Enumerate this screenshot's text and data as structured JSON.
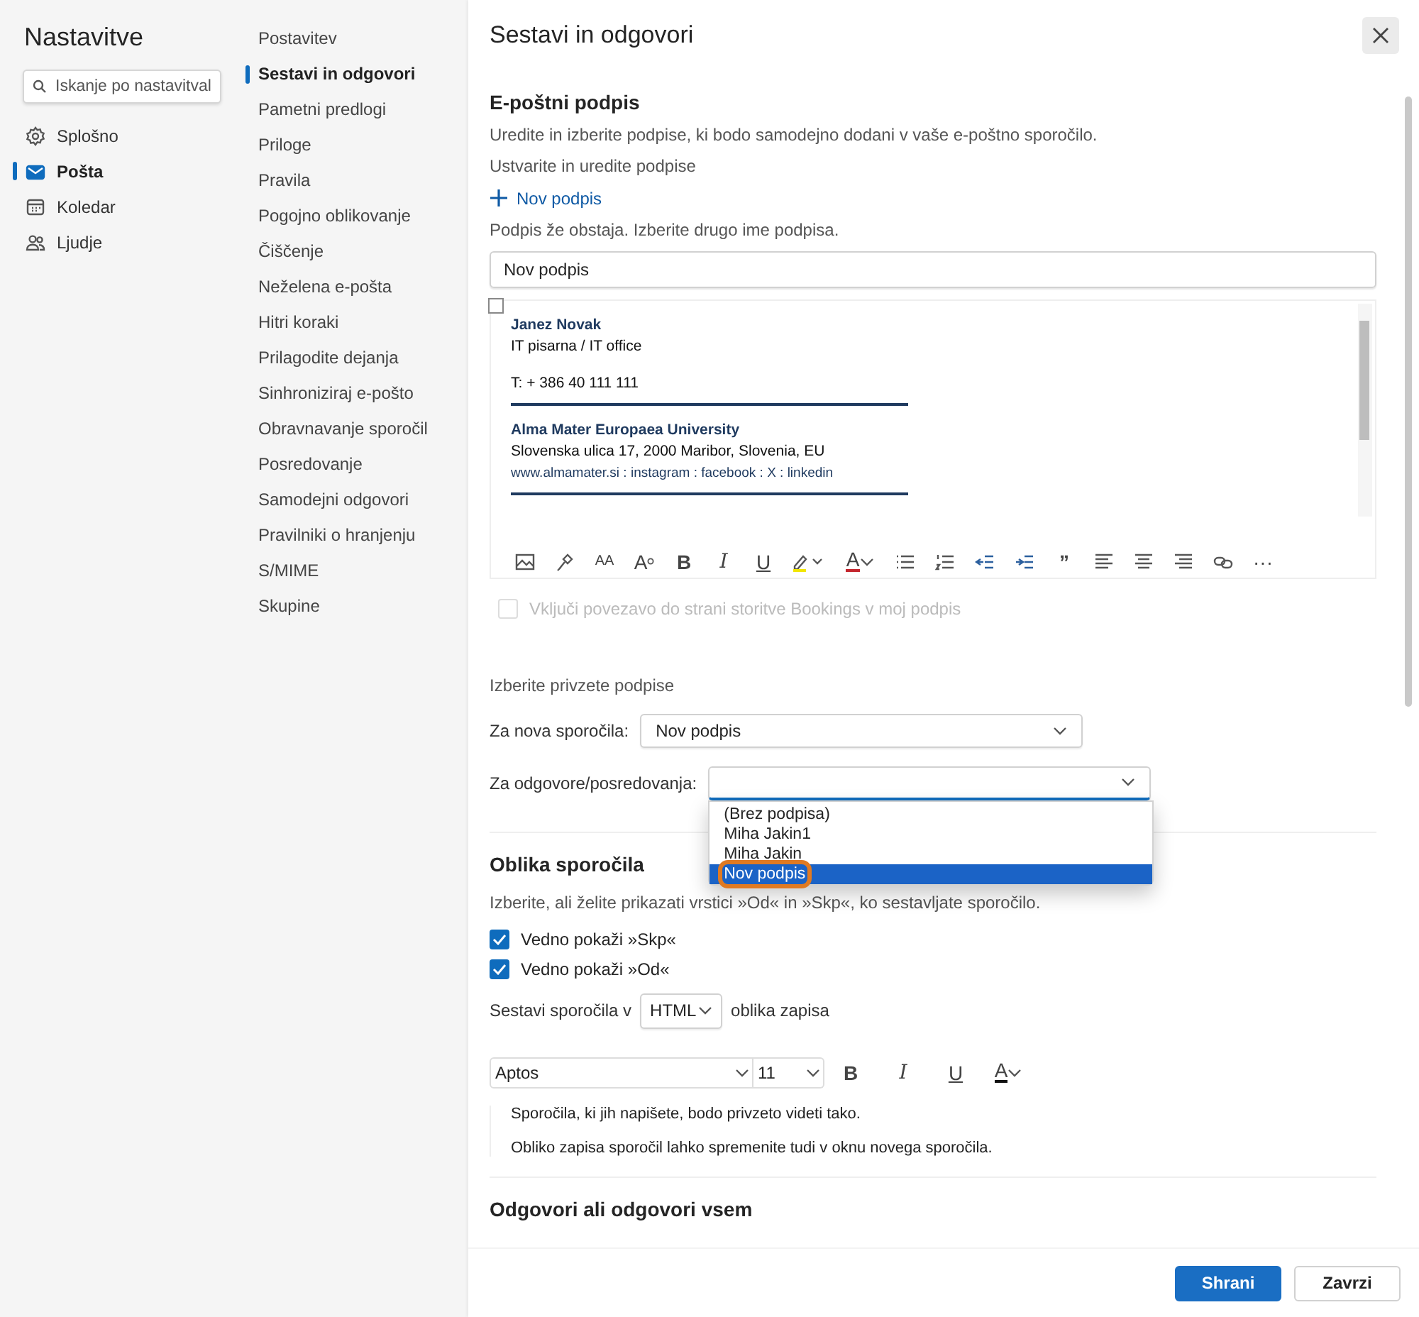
{
  "nav": {
    "title": "Nastavitve",
    "search": {
      "placeholder": "Iskanje po nastavitval"
    },
    "items": [
      {
        "kind": "general",
        "label": "Splošno",
        "selected": false
      },
      {
        "kind": "mail",
        "label": "Pošta",
        "selected": true
      },
      {
        "kind": "calendar",
        "label": "Koledar",
        "selected": false
      },
      {
        "kind": "people",
        "label": "Ljudje",
        "selected": false
      }
    ]
  },
  "sections": [
    {
      "label": "Postavitev",
      "selected": false
    },
    {
      "label": "Sestavi in odgovori",
      "selected": true
    },
    {
      "label": "Pametni predlogi",
      "selected": false
    },
    {
      "label": "Priloge",
      "selected": false
    },
    {
      "label": "Pravila",
      "selected": false
    },
    {
      "label": "Pogojno oblikovanje",
      "selected": false
    },
    {
      "label": "Čiščenje",
      "selected": false
    },
    {
      "label": "Neželena e-pošta",
      "selected": false
    },
    {
      "label": "Hitri koraki",
      "selected": false
    },
    {
      "label": "Prilagodite dejanja",
      "selected": false
    },
    {
      "label": "Sinhroniziraj e-pošto",
      "selected": false
    },
    {
      "label": "Obravnavanje sporočil",
      "selected": false
    },
    {
      "label": "Posredovanje",
      "selected": false
    },
    {
      "label": "Samodejni odgovori",
      "selected": false
    },
    {
      "label": "Pravilniki o hranjenju",
      "selected": false
    },
    {
      "label": "S/MIME",
      "selected": false
    },
    {
      "label": "Skupine",
      "selected": false
    }
  ],
  "panel": {
    "title": "Sestavi in odgovori",
    "signature": {
      "heading": "E-poštni podpis",
      "description": "Uredite in izberite podpise, ki bodo samodejno dodani v vaše e-poštno sporočilo.",
      "create_label": "Ustvarite in uredite podpise",
      "new_link": "Nov podpis",
      "error": "Podpis že obstaja. Izberite drugo ime podpisa.",
      "name_field": {
        "value": "Nov podpis"
      },
      "editor": {
        "select_all": {
          "checked": false
        },
        "lines": [
          {
            "kind": "name",
            "text": "Janez Novak"
          },
          {
            "kind": "plain",
            "text": "IT pisarna / IT office"
          },
          {
            "kind": "plain",
            "text": "T: + 386 40 111 111"
          },
          {
            "kind": "rule"
          },
          {
            "kind": "name",
            "text": "Alma Mater Europaea University"
          },
          {
            "kind": "plain",
            "text": "Slovenska ulica 17, 2000 Maribor, Slovenia, EU"
          },
          {
            "kind": "links",
            "text": "www.almamater.si : instagram : facebook : X : linkedin"
          },
          {
            "kind": "rule"
          }
        ],
        "toolbar": [
          {
            "kind": "image"
          },
          {
            "kind": "painter"
          },
          {
            "kind": "fontsize",
            "label": "AA"
          },
          {
            "kind": "superscript",
            "label": "A"
          },
          {
            "kind": "bold",
            "label": "B"
          },
          {
            "kind": "italic",
            "label": "I"
          },
          {
            "kind": "underline",
            "label": "U"
          },
          {
            "kind": "highlight"
          },
          {
            "kind": "fontcolor",
            "label": "A"
          },
          {
            "kind": "bullets"
          },
          {
            "kind": "numbering"
          },
          {
            "kind": "outdent"
          },
          {
            "kind": "indent"
          },
          {
            "kind": "quote",
            "label": "”"
          },
          {
            "kind": "alignleft"
          },
          {
            "kind": "aligncenter"
          },
          {
            "kind": "alignright"
          },
          {
            "kind": "link"
          },
          {
            "kind": "more",
            "label": "···"
          }
        ]
      },
      "bookings": {
        "label": "Vključi povezavo do strani storitve Bookings v moj podpis",
        "checked": false,
        "disabled": true
      }
    },
    "defaults": {
      "heading": "Izberite privzete podpise",
      "new_messages": {
        "label": "Za nova sporočila:",
        "value": "Nov podpis"
      },
      "replies": {
        "label": "Za odgovore/posredovanja:",
        "expanded": true,
        "options": [
          {
            "label": "(Brez podpisa)",
            "selected": false
          },
          {
            "label": "Miha Jakin1",
            "selected": false
          },
          {
            "label": "Miha Jakin",
            "selected": false
          },
          {
            "label": "Nov podpis",
            "selected": true
          }
        ]
      }
    },
    "format": {
      "heading": "Oblika sporočila",
      "description": "Izberite, ali želite prikazati vrstici »Od« in »Skp«, ko sestavljate sporočilo.",
      "options": [
        {
          "label": "Vedno pokaži »Skp«",
          "checked": true
        },
        {
          "label": "Vedno pokaži »Od«",
          "checked": true
        }
      ],
      "compose_before": "Sestavi sporočila v",
      "compose_value": "HTML",
      "compose_after": "oblika zapisa",
      "font": "Aptos",
      "size": "11",
      "toolbar": [
        {
          "kind": "bold",
          "label": "B"
        },
        {
          "kind": "italic",
          "label": "I"
        },
        {
          "kind": "underline",
          "label": "U"
        },
        {
          "kind": "fontcolor",
          "label": "A"
        }
      ],
      "preview": [
        "Sporočila, ki jih napišete, bodo privzeto videti tako.",
        "Obliko zapisa sporočil lahko spremenite tudi v oknu novega sporočila."
      ]
    },
    "next_heading": "Odgovori ali odgovori vsem",
    "buttons": [
      {
        "kind": "primary",
        "label": "Shrani"
      },
      {
        "kind": "secondary",
        "label": "Zavrzi"
      }
    ]
  }
}
